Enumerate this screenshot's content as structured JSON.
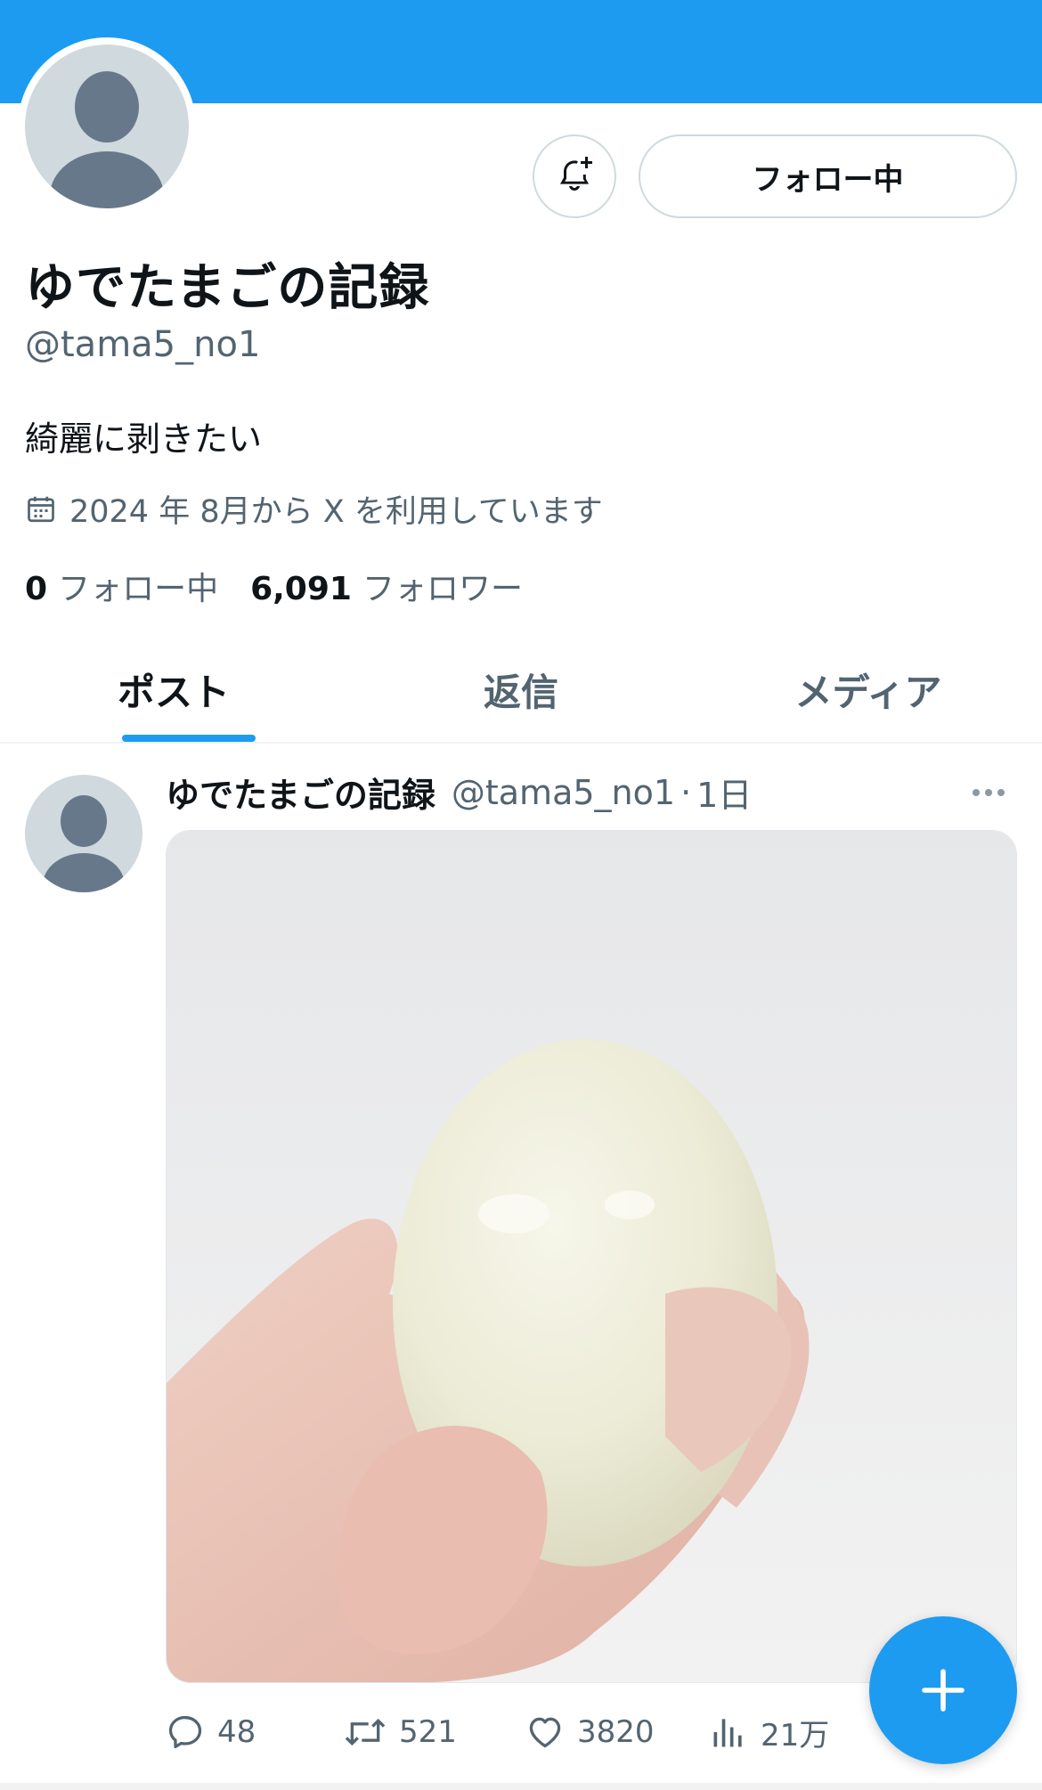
{
  "profile": {
    "display_name": "ゆでたまごの記録",
    "handle": "@tama5_no1",
    "bio": "綺麗に剥きたい",
    "joined": "2024 年 8月から X を利用しています",
    "following_count": "0",
    "following_label": "フォロー中",
    "followers_count": "6,091",
    "followers_label": "フォロワー",
    "follow_button_label": "フォロー中"
  },
  "tabs": [
    {
      "label": "ポスト",
      "active": true
    },
    {
      "label": "返信",
      "active": false
    },
    {
      "label": "メディア",
      "active": false
    }
  ],
  "post": {
    "author_name": "ゆでたまごの記録",
    "author_handle": "@tama5_no1",
    "separator": "·",
    "time": "1日",
    "image_subject": "peeled boiled egg held in hand",
    "replies": "48",
    "reposts": "521",
    "likes": "3820",
    "views": "21万"
  },
  "colors": {
    "accent": "#1d9bf0",
    "text_primary": "#0f1419",
    "text_secondary": "#536471",
    "avatar_bg": "#cfd9de"
  },
  "icons": [
    "bell-plus-icon",
    "calendar-icon",
    "more-icon",
    "reply-icon",
    "repost-icon",
    "like-icon",
    "views-icon",
    "compose-plus-icon"
  ]
}
